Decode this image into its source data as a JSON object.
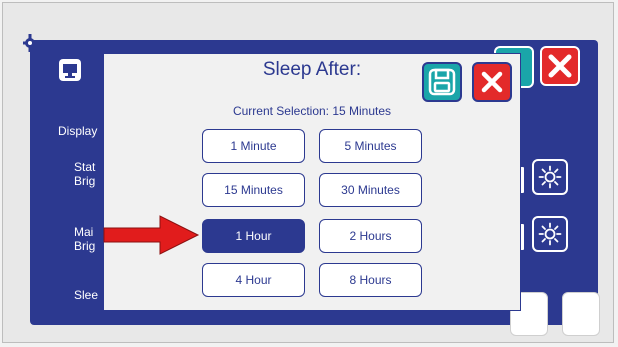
{
  "background": {
    "menu_labels": {
      "display": "Display",
      "status_brightness": [
        "Stat",
        "Brig"
      ],
      "main_brightness": [
        "Mai",
        "Brig"
      ],
      "sleep": "Slee"
    }
  },
  "dialog": {
    "title": "Sleep After:",
    "current_selection": "Current Selection: 15 Minutes",
    "options": [
      {
        "label": "1 Minute",
        "selected": false
      },
      {
        "label": "5 Minutes",
        "selected": false
      },
      {
        "label": "15 Minutes",
        "selected": false
      },
      {
        "label": "30 Minutes",
        "selected": false
      },
      {
        "label": "1 Hour",
        "selected": true
      },
      {
        "label": "2 Hours",
        "selected": false
      },
      {
        "label": "4 Hour",
        "selected": false
      },
      {
        "label": "8 Hours",
        "selected": false
      }
    ]
  },
  "colors": {
    "primary_blue": "#2c3990",
    "save_teal": "#1aa5a9",
    "close_red": "#e32a2a",
    "arrow_red": "#e11c1c"
  },
  "icons": [
    "gear-icon",
    "monitor-icon",
    "save-icon",
    "close-icon",
    "sun-icon",
    "arrow-icon"
  ]
}
